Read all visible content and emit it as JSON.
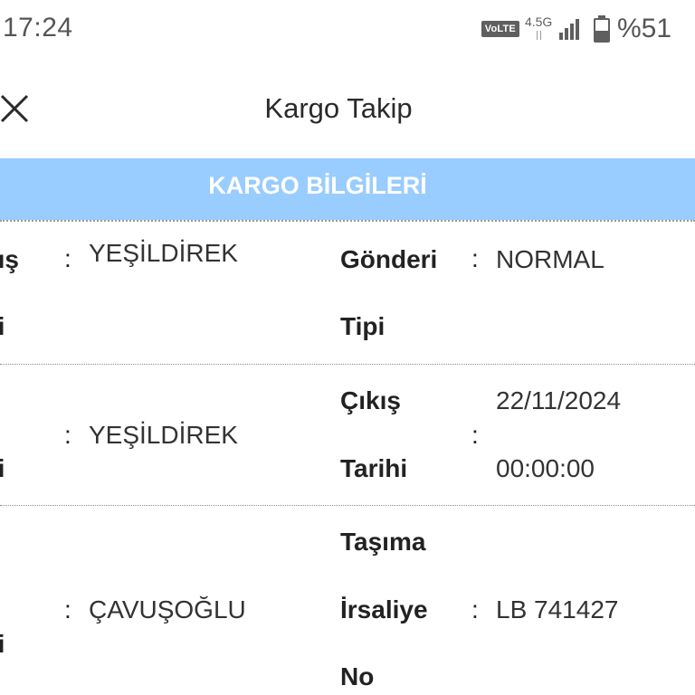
{
  "status_bar": {
    "time": "17:24",
    "volte": "VoLTE",
    "network": "4.5G",
    "battery_percent": "%51",
    "battery_level": 0.51,
    "icons": [
      "volte-icon",
      "network-4g-icon",
      "signal-icon",
      "battery-icon"
    ]
  },
  "header": {
    "title": "Kargo Takip",
    "close_icon": "close-icon"
  },
  "section": {
    "title": "KARGO BİLGİLERİ",
    "color": "#99ccff"
  },
  "rows": [
    {
      "left_label_lines": [
        "kış",
        "si"
      ],
      "left_value": "YEŞİLDİREK",
      "right_label_lines": [
        "Gönderi",
        "Tipi"
      ],
      "right_value_lines": [
        "NORMAL"
      ]
    },
    {
      "left_label_lines": [
        "si"
      ],
      "left_value": "YEŞİLDİREK",
      "right_label_lines": [
        "Çıkış",
        "Tarihi"
      ],
      "right_value_lines": [
        "22/11/2024",
        "00:00:00"
      ]
    },
    {
      "left_label_lines": [
        "si"
      ],
      "left_value": "ÇAVUŞOĞLU",
      "right_label_lines": [
        "Taşıma",
        "İrsaliye",
        "No"
      ],
      "right_value_lines": [
        "LB 741427"
      ]
    }
  ],
  "separator": ":"
}
